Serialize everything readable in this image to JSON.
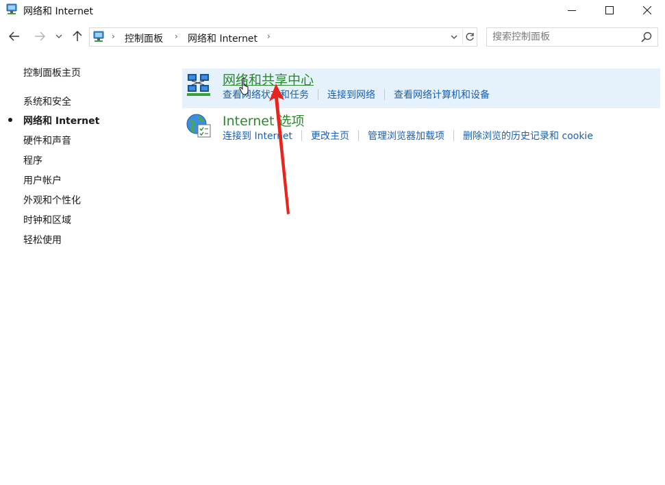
{
  "window": {
    "title": "网络和 Internet",
    "controls": {
      "minimize": "minimize",
      "maximize": "maximize",
      "close": "close"
    }
  },
  "navigation": {
    "breadcrumbs": [
      "控制面板",
      "网络和 Internet"
    ],
    "search_placeholder": "搜索控制面板"
  },
  "sidebar": {
    "items": [
      {
        "label": "控制面板主页",
        "active": false
      },
      {
        "label": "系统和安全",
        "active": false
      },
      {
        "label": "网络和 Internet",
        "active": true
      },
      {
        "label": "硬件和声音",
        "active": false
      },
      {
        "label": "程序",
        "active": false
      },
      {
        "label": "用户帐户",
        "active": false
      },
      {
        "label": "外观和个性化",
        "active": false
      },
      {
        "label": "时钟和区域",
        "active": false
      },
      {
        "label": "轻松使用",
        "active": false
      }
    ]
  },
  "categories": [
    {
      "title": "网络和共享中心",
      "icon": "network-sharing-icon",
      "links": [
        "查看网络状态和任务",
        "连接到网络",
        "查看网络计算机和设备"
      ]
    },
    {
      "title": "Internet 选项",
      "icon": "internet-options-icon",
      "links": [
        "连接到 Internet",
        "更改主页",
        "管理浏览器加载项",
        "删除浏览的历史记录和 cookie"
      ]
    }
  ],
  "colors": {
    "category_title": "#2a8a2a",
    "link": "#1a5fb4",
    "highlight": "#e5f1fb",
    "annotation_arrow": "#e8251c"
  }
}
